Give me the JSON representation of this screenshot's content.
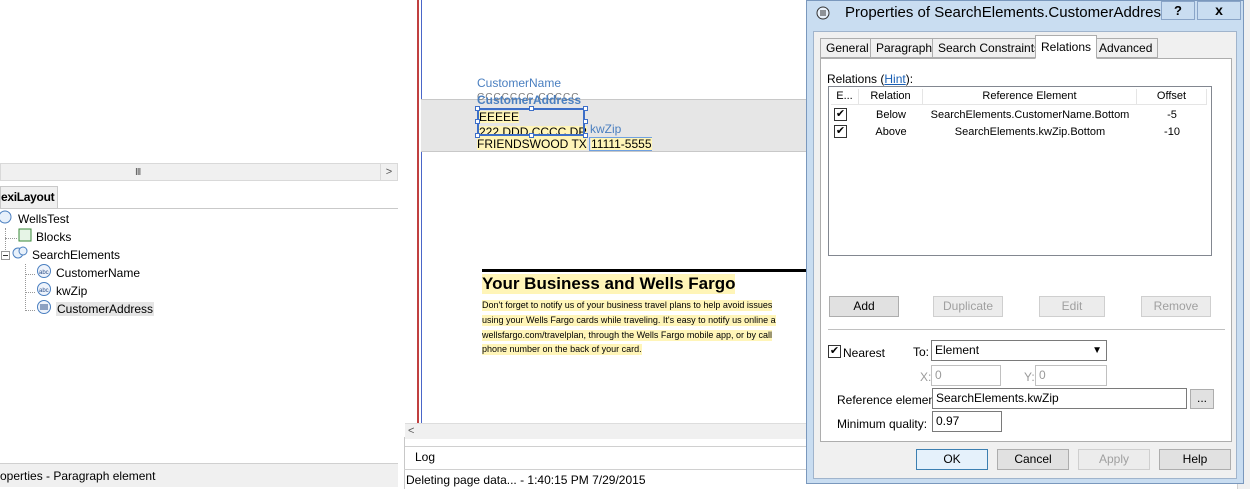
{
  "left": {
    "scroll_grip": "III",
    "scroll_right": ">",
    "tree_tab": "exiLayout",
    "tree": {
      "root": "WellsTest",
      "blocks": "Blocks",
      "search_elements": "SearchElements",
      "customer_name": "CustomerName",
      "kwzip": "kwZip",
      "customer_address": "CustomerAddress"
    },
    "status": "operties - Paragraph element"
  },
  "document": {
    "label_customer_name": "CustomerName",
    "label_customer_address": "CustomerAddress",
    "line_eeeee": "EEEEE",
    "line_address1": "222 DDD CCCC DR",
    "label_kwzip": "kwZip",
    "line_city": "FRIENDSWOOD TX",
    "line_zip": "11111-5555",
    "article_title": "Your Business and Wells Fargo",
    "para_lines": [
      "Don't forget to notify us of your business travel plans to help avoid issues",
      "using your Wells Fargo cards while traveling. It's easy to notify us online a",
      "wellsfargo.com/travelplan, through the Wells Fargo mobile app, or by call",
      "phone number on the back of your card."
    ],
    "scroll_left": "<",
    "log_tab": "Log",
    "status": "Deleting page data... - 1:40:15 PM 7/29/2015"
  },
  "dialog": {
    "title": "Properties of SearchElements.CustomerAddress",
    "help_btn": "?",
    "close_btn": "x",
    "tabs": [
      "General",
      "Paragraph",
      "Search Constraints",
      "Relations",
      "Advanced"
    ],
    "relations_label": "Relations (",
    "hint_link": "Hint",
    "relations_label_end": "):",
    "columns": [
      "E...",
      "Relation",
      "Reference Element",
      "Offset"
    ],
    "rows": [
      {
        "enabled": true,
        "relation": "Below",
        "reference": "SearchElements.CustomerName.Bottom",
        "offset": "-5"
      },
      {
        "enabled": true,
        "relation": "Above",
        "reference": "SearchElements.kwZip.Bottom",
        "offset": "-10"
      }
    ],
    "add": "Add",
    "duplicate": "Duplicate",
    "edit": "Edit",
    "remove": "Remove",
    "nearest_label": "Nearest",
    "nearest_checked": true,
    "to_label": "To:",
    "to_value": "Element",
    "x_label": "X:",
    "x_value": "0",
    "y_label": "Y:",
    "y_value": "0",
    "ref_label": "Reference element:",
    "ref_value": "SearchElements.kwZip",
    "browse": "...",
    "minq_label": "Minimum quality:",
    "minq_value": "0.97",
    "ok": "OK",
    "cancel": "Cancel",
    "apply": "Apply",
    "help": "Help"
  },
  "colors": {
    "dialog_frame": "#c9ddf1",
    "doc_label_blue": "#4a7fc0",
    "highlight": "#fff5b8",
    "selection": "#3d6fc8"
  }
}
